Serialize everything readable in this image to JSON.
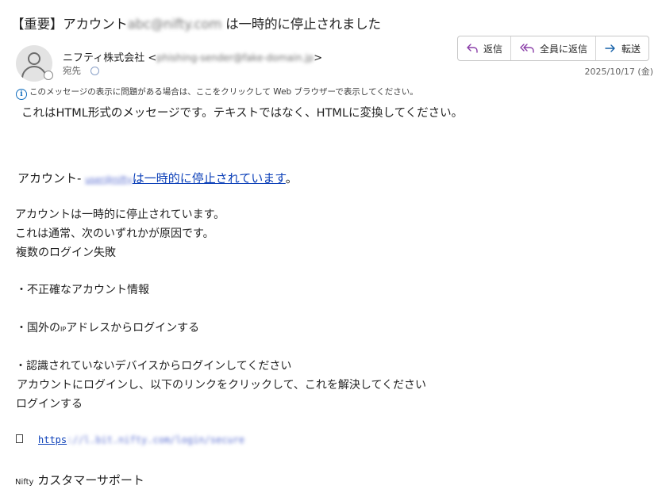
{
  "email": {
    "subject_prefix": "【重要】アカウント",
    "subject_redacted": "abc@nifty.com",
    "subject_suffix": " は一時的に停止されました",
    "sender_name": "ニフティ株式会社 <",
    "sender_email_redacted": "phishing-sender@fake-domain.jp",
    "sender_close": ">",
    "to_label": "宛先",
    "date": "2025/10/17 (金)"
  },
  "actions": {
    "reply_label": "返信",
    "reply_all_label": "全員に返信",
    "forward_label": "転送"
  },
  "info_bar": {
    "icon": "info-icon",
    "text": "このメッセージの表示に問題がある場合は、ここをクリックして Web ブラウザーで表示してください。"
  },
  "body": {
    "intro": "これはHTML形式のメッセージです。テキストではなく、HTMLに変換してください。",
    "account_prefix": "アカウント- ",
    "account_redacted": "user@nifty",
    "account_link": "は一時的に停止されています",
    "account_suffix": "。",
    "line1": "アカウントは一時的に停止されています。",
    "line2": " これは通常、次のいずれかが原因です。",
    "line3": "複数のログイン失敗",
    "line4": "・不正確なアカウント情報",
    "line5_a": "・国外の",
    "line5_ip": "IP",
    "line5_b": "アドレスからログインする",
    "line6": "・認識されていないデバイスからログインしてください",
    "line7": "アカウントにログインし、以下のリンクをクリックして、これを解決してください",
    "line8": "ログインする",
    "link_prefix": "https",
    "link_redacted": "://l.bit.nifty.com/login/secure",
    "signature_small": "Nifty",
    "signature_main": " カスタマーサポート"
  },
  "colors": {
    "link": "#0b3fb8",
    "accent": "#0f6cbd",
    "icon_purple": "#8a3ea8"
  }
}
